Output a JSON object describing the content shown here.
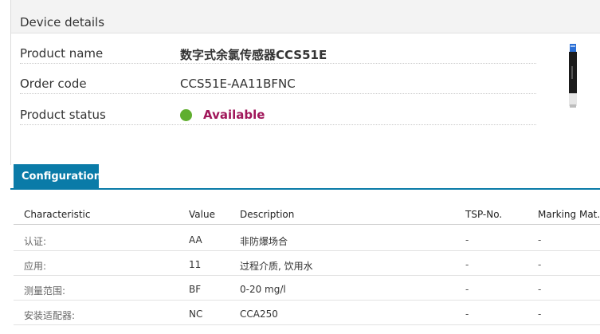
{
  "device_details": {
    "title": "Device details",
    "product_name_label": "Product name",
    "product_name_value": "数字式余氯传感器CCS51E",
    "order_code_label": "Order code",
    "order_code_value": "CCS51E-AA11BFNC",
    "product_status_label": "Product status",
    "product_status_value": "Available",
    "status_color": "#5fae2e"
  },
  "configuration": {
    "tab_label": "Configuration",
    "tab_color": "#0a7ba8",
    "columns": [
      "Characteristic",
      "Value",
      "Description",
      "TSP-No.",
      "Marking Mat."
    ],
    "rows": [
      {
        "characteristic": "认证:",
        "value": "AA",
        "description": "非防爆场合",
        "tsp": "-",
        "marking": "-"
      },
      {
        "characteristic": "应用:",
        "value": "11",
        "description": "过程介质, 饮用水",
        "tsp": "-",
        "marking": "-"
      },
      {
        "characteristic": "测量范围:",
        "value": "BF",
        "description": "0-20 mg/l",
        "tsp": "-",
        "marking": "-"
      },
      {
        "characteristic": "安装适配器:",
        "value": "NC",
        "description": "CCA250",
        "tsp": "-",
        "marking": "-"
      }
    ]
  }
}
